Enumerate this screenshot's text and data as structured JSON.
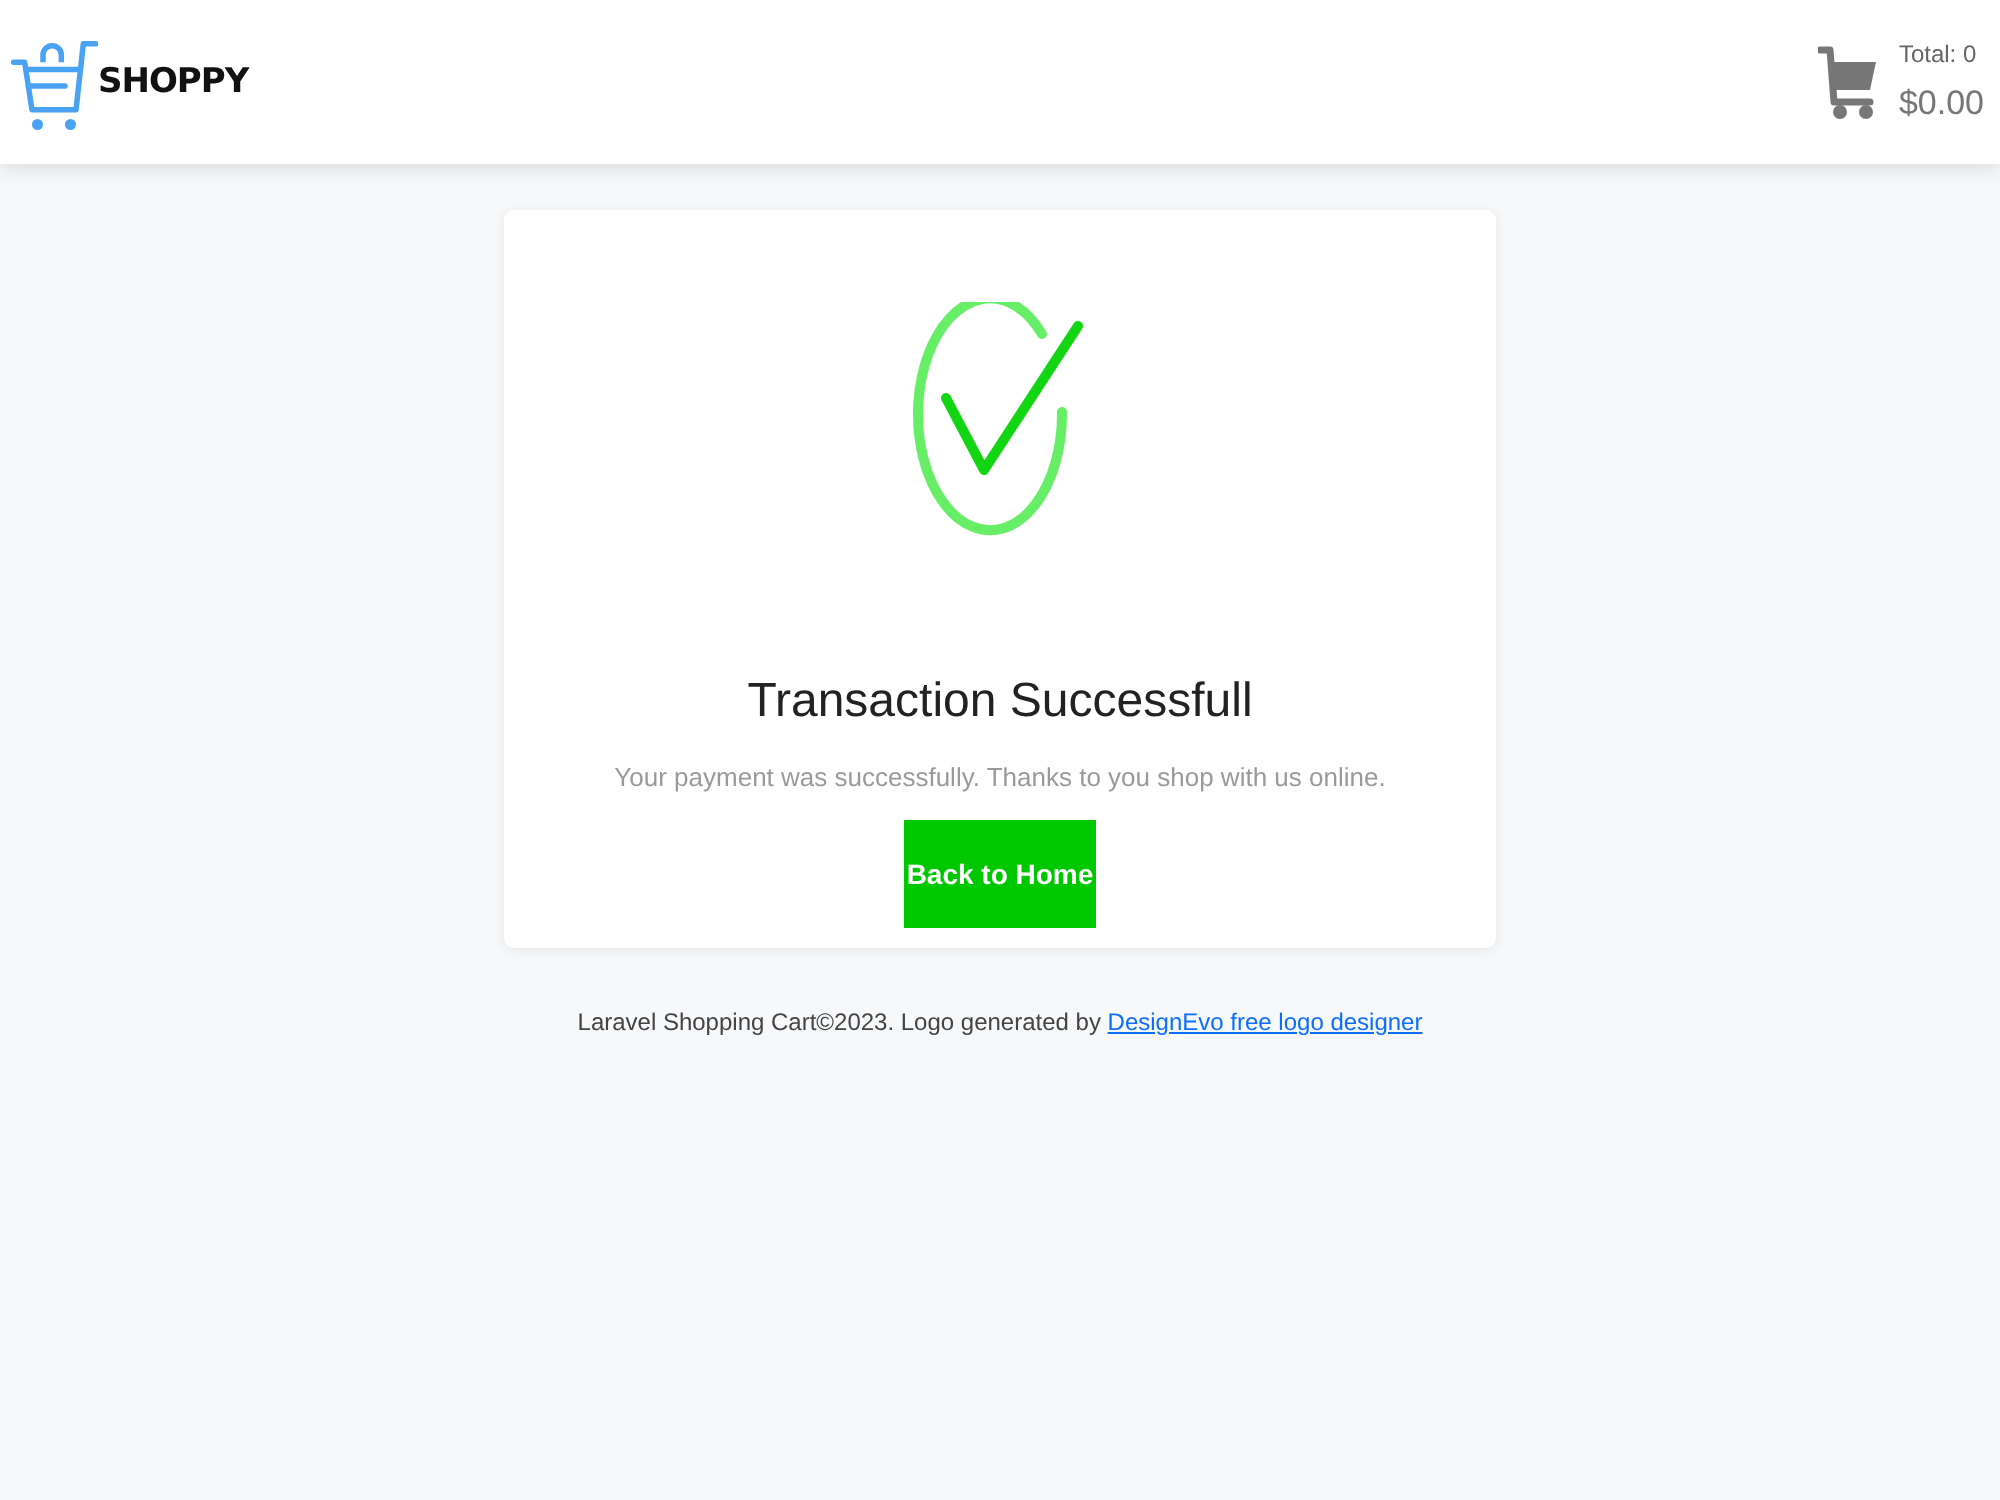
{
  "header": {
    "logo": {
      "name": "SHOPPY"
    },
    "cart": {
      "total_label": "Total: 0",
      "amount": "$0.00"
    }
  },
  "card": {
    "title": "Transaction Successfull",
    "message": "Your payment was successfully. Thanks to you shop with us online.",
    "button": "Back to Home"
  },
  "footer": {
    "text": "Laravel Shopping Cart©2023. Logo generated by",
    "link": "DesignEvo free logo designer"
  }
}
